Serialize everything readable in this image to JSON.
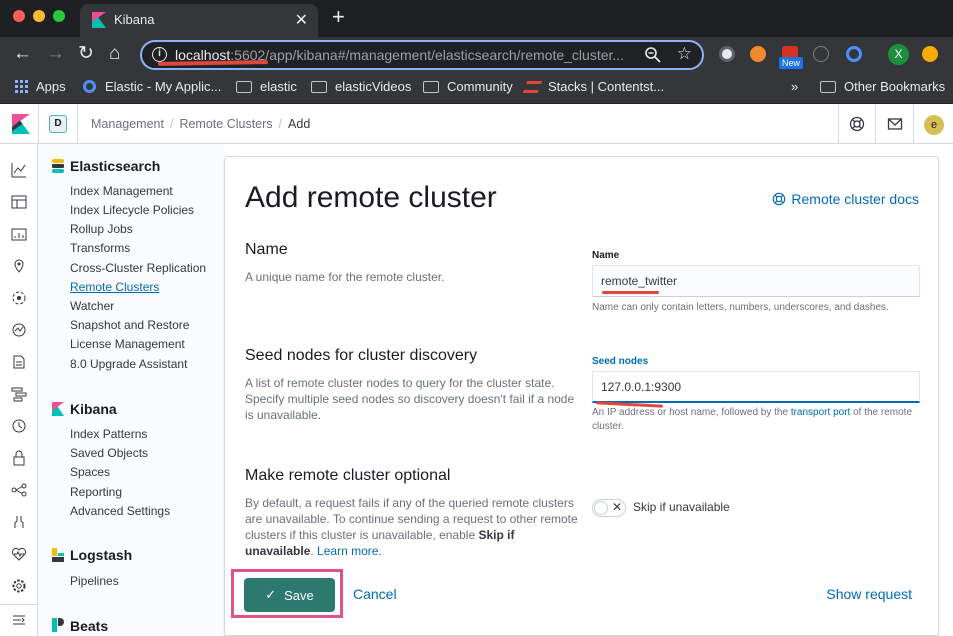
{
  "browser": {
    "tab_title": "Kibana",
    "url_host": "localhost",
    "url_rest": ":5602/app/kibana#/management/elasticsearch/remote_cluster...",
    "new_badge": "New",
    "profile_initial": "X",
    "bookmarks": [
      "Apps",
      "Elastic - My Applic...",
      "elastic",
      "elasticVideos",
      "Community",
      "Stacks | Contentst...",
      "»",
      "Other Bookmarks"
    ]
  },
  "header": {
    "space_initial": "D",
    "breadcrumbs": [
      "Management",
      "Remote Clusters",
      "Add"
    ],
    "user_initial": "e"
  },
  "sidebar": {
    "elasticsearch": {
      "title": "Elasticsearch",
      "items": [
        "Index Management",
        "Index Lifecycle Policies",
        "Rollup Jobs",
        "Transforms",
        "Cross-Cluster Replication",
        "Remote Clusters",
        "Watcher",
        "Snapshot and Restore",
        "License Management",
        "8.0 Upgrade Assistant"
      ]
    },
    "kibana": {
      "title": "Kibana",
      "items": [
        "Index Patterns",
        "Saved Objects",
        "Spaces",
        "Reporting",
        "Advanced Settings"
      ]
    },
    "logstash": {
      "title": "Logstash",
      "items": [
        "Pipelines"
      ]
    },
    "beats": {
      "title": "Beats"
    }
  },
  "form": {
    "title": "Add remote cluster",
    "docs_link": "Remote cluster docs",
    "name": {
      "heading": "Name",
      "description": "A unique name for the remote cluster.",
      "label": "Name",
      "value": "remote_twitter",
      "help": "Name can only contain letters, numbers, underscores, and dashes."
    },
    "seeds": {
      "heading": "Seed nodes for cluster discovery",
      "description": "A list of remote cluster nodes to query for the cluster state. Specify multiple seed nodes so discovery doesn't fail if a node is unavailable.",
      "label": "Seed nodes",
      "value": "127.0.0.1:9300",
      "help_pre": "An IP address or host name, followed by the ",
      "help_link": "transport port",
      "help_post": " of the remote cluster."
    },
    "optional": {
      "heading": "Make remote cluster optional",
      "description": "By default, a request fails if any of the queried remote clusters are unavailable. To continue sending a request to other remote clusters if this cluster is unavailable, enable ",
      "description_bold": "Skip if unavailable",
      "learn_more": "Learn more.",
      "toggle_label": "Skip if unavailable",
      "toggle_on": false
    },
    "save_label": "Save",
    "cancel_label": "Cancel",
    "show_request_label": "Show request"
  },
  "colors": {
    "accent": "#006bb4",
    "save_button": "#2c7a6e",
    "annotation_red": "#e0473b",
    "annotation_pink": "#e0508c"
  }
}
